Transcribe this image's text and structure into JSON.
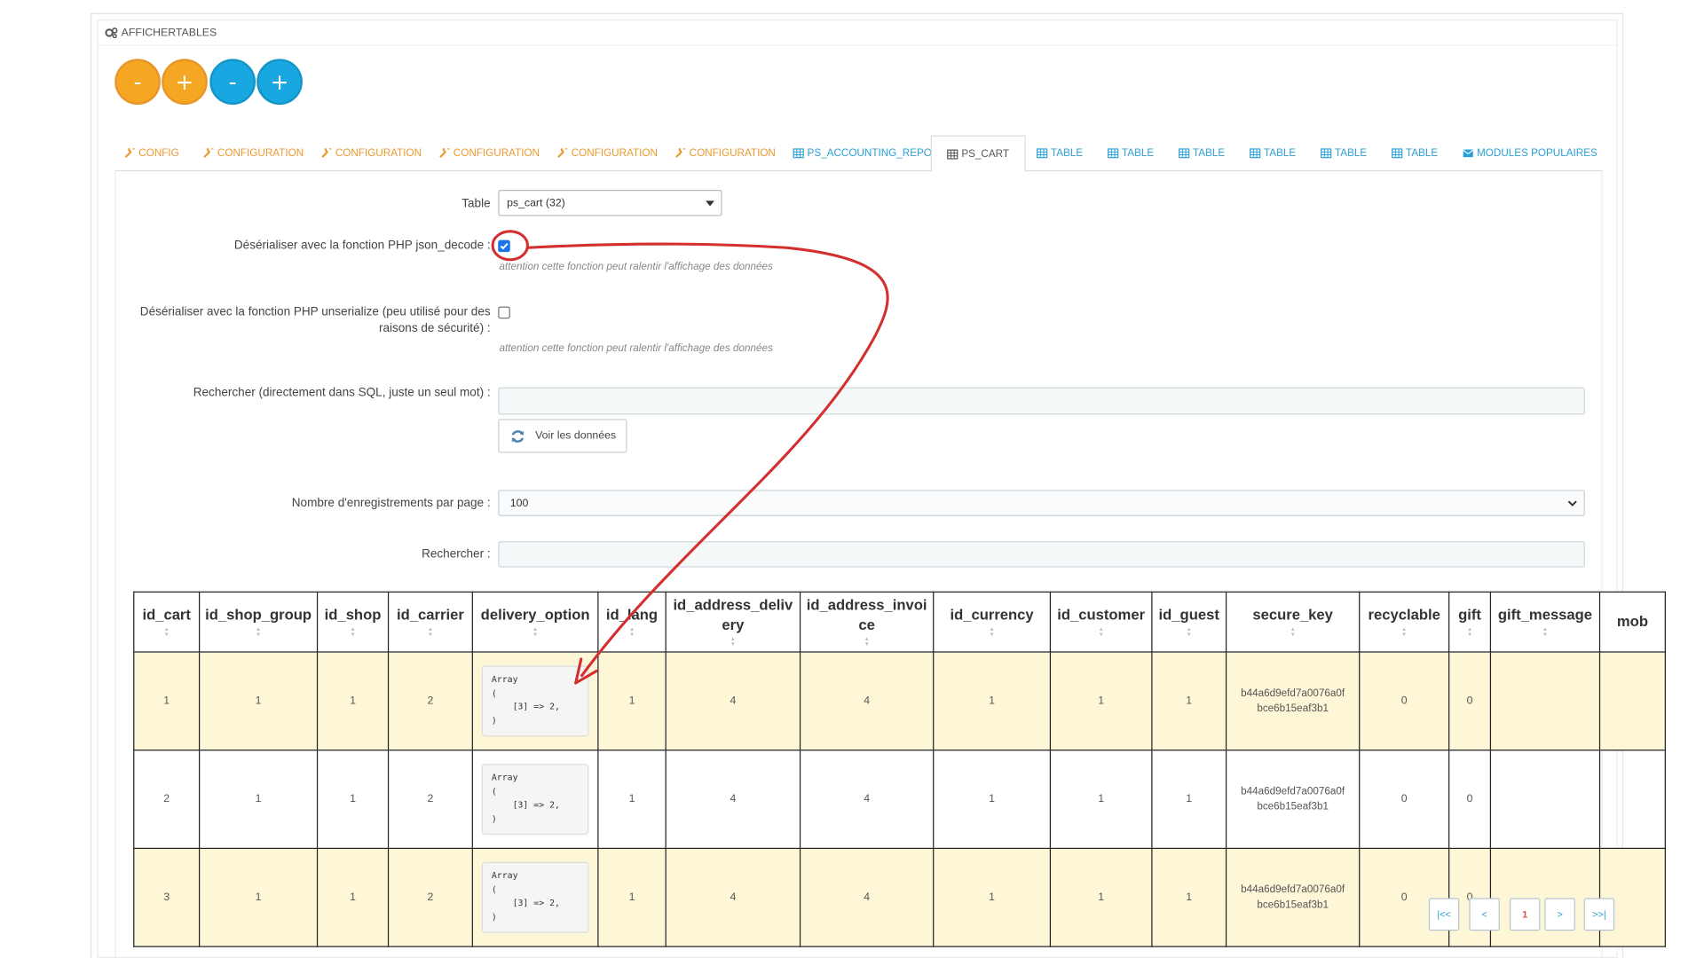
{
  "module": {
    "title": "AFFICHERTABLES"
  },
  "circle_buttons": [
    "-",
    "+",
    "-",
    "+"
  ],
  "tabs": [
    {
      "label": "CONFIG",
      "icon": "wrench-icon"
    },
    {
      "label": "CONFIGURATION",
      "icon": "wrench-icon"
    },
    {
      "label": "CONFIGURATION",
      "icon": "wrench-icon"
    },
    {
      "label": "CONFIGURATION",
      "icon": "wrench-icon"
    },
    {
      "label": "CONFIGURATION",
      "icon": "wrench-icon"
    },
    {
      "label": "CONFIGURATION",
      "icon": "wrench-icon"
    },
    {
      "label": "PS_ACCOUNTING_REPORTS",
      "icon": "table-icon"
    },
    {
      "label": "PS_CART",
      "icon": "table-icon",
      "active": true
    },
    {
      "label": "TABLE",
      "icon": "table-icon"
    },
    {
      "label": "TABLE",
      "icon": "table-icon"
    },
    {
      "label": "TABLE",
      "icon": "table-icon"
    },
    {
      "label": "TABLE",
      "icon": "table-icon"
    },
    {
      "label": "TABLE",
      "icon": "table-icon"
    },
    {
      "label": "TABLE",
      "icon": "table-icon"
    },
    {
      "label": "MODULES POPULAIRES",
      "icon": "envelope-icon"
    }
  ],
  "form": {
    "table_label": "Table",
    "table_value": "ps_cart (32)",
    "json_label": "Désérialiser avec la fonction PHP json_decode :",
    "json_checked": true,
    "json_hint": "attention cette fonction peut ralentir l'affichage des données",
    "unserialize_label_line1": "Désérialiser avec la fonction PHP unserialize (peu utilisé pour des",
    "unserialize_label_line2": "raisons de sécurité) :",
    "unserialize_checked": false,
    "unserialize_hint": "attention cette fonction peut ralentir l'affichage des données",
    "sql_search_label": "Rechercher (directement dans SQL, juste un seul mot) :",
    "sql_search_value": "",
    "view_button": "Voir les données",
    "per_page_label": "Nombre d'enregistrements par page :",
    "per_page_value": "100",
    "search_label": "Rechercher :",
    "search_value": ""
  },
  "table": {
    "columns": [
      [
        "id_cart"
      ],
      [
        "id_shop_group"
      ],
      [
        "id_shop"
      ],
      [
        "id_carrier"
      ],
      [
        "delivery_option"
      ],
      [
        "id_lang"
      ],
      [
        "id_address_deliv",
        "ery"
      ],
      [
        "id_address_invoi",
        "ce"
      ],
      [
        "id_currency"
      ],
      [
        "id_customer"
      ],
      [
        "id_guest"
      ],
      [
        "secure_key"
      ],
      [
        "recyclable"
      ],
      [
        "gift"
      ],
      [
        "gift_message"
      ],
      [
        "mob"
      ]
    ],
    "rows": [
      [
        "1",
        "1",
        "1",
        "2",
        "Array\n(\n    [3] => 2,\n)",
        "1",
        "4",
        "4",
        "1",
        "1",
        "1",
        "b44a6d9efd7a0076a0f\nbce6b15eaf3b1",
        "0",
        "0",
        "",
        ""
      ],
      [
        "2",
        "1",
        "1",
        "2",
        "Array\n(\n    [3] => 2,\n)",
        "1",
        "4",
        "4",
        "1",
        "1",
        "1",
        "b44a6d9efd7a0076a0f\nbce6b15eaf3b1",
        "0",
        "0",
        "",
        ""
      ],
      [
        "3",
        "1",
        "1",
        "2",
        "Array\n(\n    [3] => 2,\n)",
        "1",
        "4",
        "4",
        "1",
        "1",
        "1",
        "b44a6d9efd7a0076a0f\nbce6b15eaf3b1",
        "0",
        "0",
        "",
        ""
      ]
    ]
  },
  "pagination": [
    "|<<",
    "<",
    "1",
    ">",
    ">>|"
  ],
  "colors": {
    "orange": "#f5a623",
    "blue": "#19a7e2",
    "row_highlight": "#fdf7d7",
    "annotation_red": "#d32f2f"
  }
}
